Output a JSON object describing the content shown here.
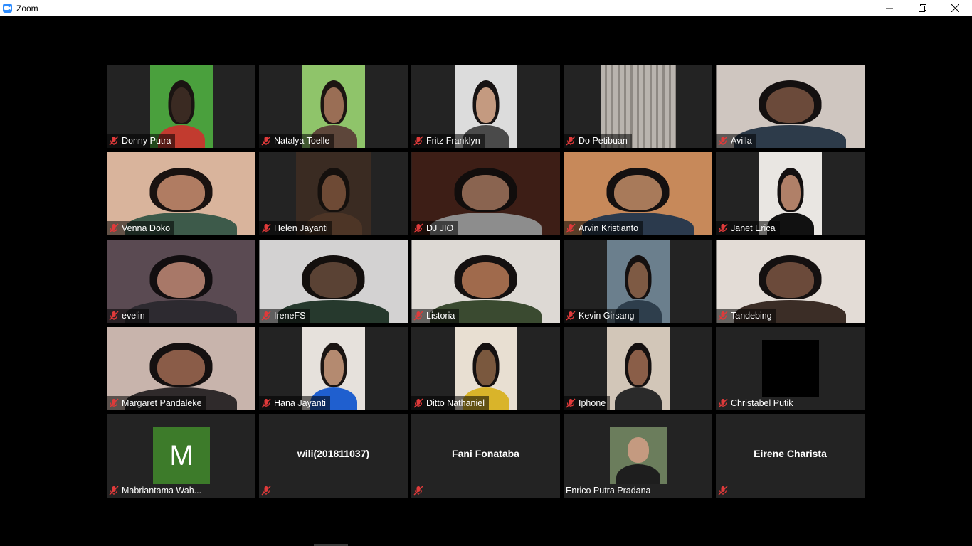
{
  "window": {
    "title": "Zoom"
  },
  "participants": [
    {
      "name": "Donny Putra",
      "muted": true,
      "video": "w88",
      "bg": "#4aa03d",
      "skin": "#3a2a22",
      "shirt": "#c23b2f",
      "hair": "#1a1412"
    },
    {
      "name": "Natalya Toelle",
      "muted": true,
      "video": "w88",
      "bg": "#8fc46a",
      "skin": "#9a6e55",
      "shirt": "#5d463a",
      "hair": "#1c1512"
    },
    {
      "name": "Fritz Franklyn",
      "muted": true,
      "video": "w88",
      "bg": "#dcdcdc",
      "skin": "#c49a80",
      "shirt": "#4a4a4a",
      "hair": "#171313"
    },
    {
      "name": "Do Petibuan",
      "muted": true,
      "video": "w106",
      "bg": "#a9a39c",
      "skin": "",
      "shirt": "",
      "hair": ""
    },
    {
      "name": "Avilla",
      "muted": true,
      "video": "full",
      "bg": "#cfc6c0",
      "skin": "#6b4a3a",
      "shirt": "#2d3b4a",
      "hair": "#141010"
    },
    {
      "name": "Venna Doko",
      "muted": true,
      "video": "full",
      "bg": "#d9b49c",
      "skin": "#b07c62",
      "shirt": "#3d5a4a",
      "hair": "#1a1210"
    },
    {
      "name": "Helen Jayanti",
      "muted": true,
      "video": "w106",
      "bg": "#3a2b22",
      "skin": "#6e4a35",
      "shirt": "#4d3526",
      "hair": "#15100d"
    },
    {
      "name": "DJ JIO",
      "muted": true,
      "video": "full",
      "bg": "#3d1e16",
      "skin": "#8a6450",
      "shirt": "#8d8d8d",
      "hair": "#110d0c"
    },
    {
      "name": "Arvin Kristianto",
      "muted": true,
      "video": "full",
      "bg": "#c7895a",
      "skin": "#a87a5a",
      "shirt": "#2b3a4d",
      "hair": "#141010"
    },
    {
      "name": "Janet Erica",
      "muted": true,
      "video": "w88",
      "bg": "#e9e6e2",
      "skin": "#b08068",
      "shirt": "#111111",
      "hair": "#141010"
    },
    {
      "name": "evelin",
      "muted": true,
      "video": "full",
      "bg": "#5a4a52",
      "skin": "#a87868",
      "shirt": "#2d2a30",
      "hair": "#120e10"
    },
    {
      "name": "IreneFS",
      "muted": true,
      "video": "full",
      "bg": "#d3d2d2",
      "skin": "#5a4234",
      "shirt": "#26392d",
      "hair": "#130f0d"
    },
    {
      "name": "Listoria",
      "muted": true,
      "video": "full",
      "bg": "#ddd9d4",
      "skin": "#a06a4c",
      "shirt": "#3a4a30",
      "hair": "#141010"
    },
    {
      "name": "Kevin Girsang",
      "muted": true,
      "video": "w88",
      "bg": "#6b7f8d",
      "skin": "#7e5a44",
      "shirt": "#2e3e4c",
      "hair": "#141010"
    },
    {
      "name": "Tandebing",
      "muted": true,
      "video": "full",
      "bg": "#e3dcd6",
      "skin": "#6b4a3a",
      "shirt": "#3b2d26",
      "hair": "#141010"
    },
    {
      "name": "Margaret Pandaleke",
      "muted": true,
      "video": "full",
      "bg": "#c8b4ac",
      "skin": "#8a5c48",
      "shirt": "#2f2a2b",
      "hair": "#141010"
    },
    {
      "name": "Hana Jayanti",
      "muted": true,
      "video": "w88",
      "bg": "#e6e1dc",
      "skin": "#b48a70",
      "shirt": "#1f5fcf",
      "hair": "#1a1412"
    },
    {
      "name": "Ditto Nathaniel",
      "muted": true,
      "video": "w88",
      "bg": "#e8dfd2",
      "skin": "#7a583e",
      "shirt": "#d9b42a",
      "hair": "#141010"
    },
    {
      "name": "Iphone",
      "muted": true,
      "video": "w88",
      "bg": "#d2c6b8",
      "skin": "#8a5e48",
      "shirt": "#2a2a2a",
      "hair": "#141010"
    },
    {
      "name": "Christabel Putik",
      "muted": true,
      "video": "black",
      "bg": "#000000",
      "skin": "",
      "shirt": "",
      "hair": ""
    },
    {
      "name": "Mabriantama Wah...",
      "muted": true,
      "video": "avatar",
      "avatar_letter": "M",
      "bg": "#3d7b2a",
      "skin": "",
      "shirt": "",
      "hair": ""
    },
    {
      "name": "",
      "display_name": "wili(201811037)",
      "muted": true,
      "video": "none",
      "bg": "",
      "skin": "",
      "shirt": "",
      "hair": ""
    },
    {
      "name": "",
      "display_name": "Fani Fonataba",
      "muted": true,
      "video": "none",
      "bg": "",
      "skin": "",
      "shirt": "",
      "hair": ""
    },
    {
      "name": "Enrico Putra Pradana",
      "muted": false,
      "video": "photo",
      "bg": "#6b7d5c",
      "skin": "#c49a80",
      "shirt": "#1e1e1e",
      "hair": "#141010"
    },
    {
      "name": "",
      "display_name": "Eirene Charista",
      "muted": true,
      "video": "none",
      "bg": "",
      "skin": "",
      "shirt": "",
      "hair": ""
    }
  ]
}
